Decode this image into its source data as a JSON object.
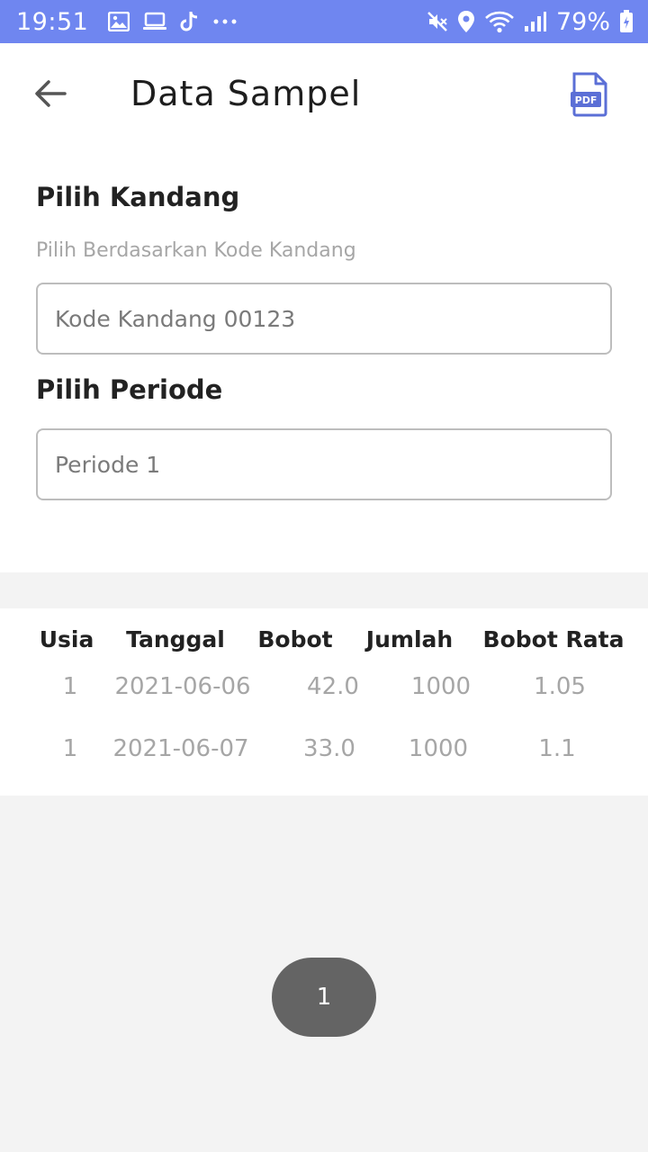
{
  "status_bar": {
    "time": "19:51",
    "battery": "79%",
    "left_icons": [
      "image-icon",
      "laptop-icon",
      "tiktok-icon",
      "more-icon"
    ],
    "right_icons": [
      "mute-icon",
      "location-icon",
      "wifi-icon",
      "signal-icon",
      "battery-charging-icon"
    ]
  },
  "header": {
    "title": "Data Sampel",
    "pdf_label": "PDF"
  },
  "form": {
    "kandang_title": "Pilih Kandang",
    "kandang_hint": "Pilih Berdasarkan Kode Kandang",
    "kandang_value": "Kode Kandang 00123",
    "periode_title": "Pilih Periode",
    "periode_value": "Periode 1"
  },
  "table": {
    "headers": [
      "Usia",
      "Tanggal",
      "Bobot",
      "Jumlah",
      "Bobot Rata"
    ],
    "rows": [
      [
        "1",
        "2021-06-06",
        "42.0",
        "1000",
        "1.05"
      ],
      [
        "1",
        "2021-06-07",
        "33.0",
        "1000",
        "1.1"
      ]
    ]
  },
  "pagination": {
    "current_page": "1"
  },
  "colors": {
    "status_bar": "#6f86f0",
    "pdf_icon": "#5b6fd6",
    "pager": "#646464"
  }
}
